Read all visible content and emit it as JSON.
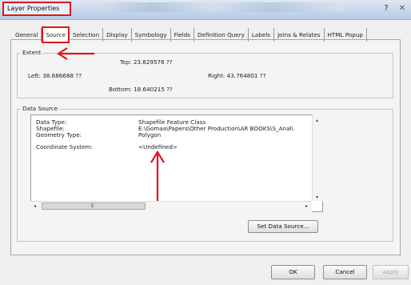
{
  "window": {
    "title": "Layer Properties",
    "help_glyph": "?",
    "close_glyph": "✕"
  },
  "tabs": [
    {
      "label": "General"
    },
    {
      "label": "Source",
      "active": true
    },
    {
      "label": "Selection"
    },
    {
      "label": "Display"
    },
    {
      "label": "Symbology"
    },
    {
      "label": "Fields"
    },
    {
      "label": "Definition Query"
    },
    {
      "label": "Labels"
    },
    {
      "label": "Joins & Relates"
    },
    {
      "label": "HTML Popup"
    }
  ],
  "extent": {
    "legend": "Extent",
    "top": "Top:  23.829576 ??",
    "left": "Left:  38.686688 ??",
    "right": "Right:  43.764801 ??",
    "bottom": "Bottom:  18.640215 ??"
  },
  "data_source": {
    "legend": "Data Source",
    "rows": [
      {
        "label": "Data Type:",
        "value": "Shapefile Feature Class"
      },
      {
        "label": "Shapefile:",
        "value": "E:\\Gomaa\\Papers\\Other Production\\AR BOOKS\\S_Anal\\"
      },
      {
        "label": "Geometry Type:",
        "value": "Polygon"
      },
      {
        "label": "Coordinate System:",
        "value": "<Undefined>"
      }
    ],
    "set_button": "Set Data Source...",
    "scroll_left": "◂",
    "scroll_right": "▸",
    "scroll_up": "▴",
    "scroll_down": "▾",
    "thumb_grip": "⦀"
  },
  "footer": {
    "ok": "OK",
    "cancel": "Cancel",
    "apply": "Apply"
  },
  "colors": {
    "annotation": "#e0161b",
    "title_gradient_top": "#dfe9f5",
    "panel": "#f4f4f4"
  }
}
